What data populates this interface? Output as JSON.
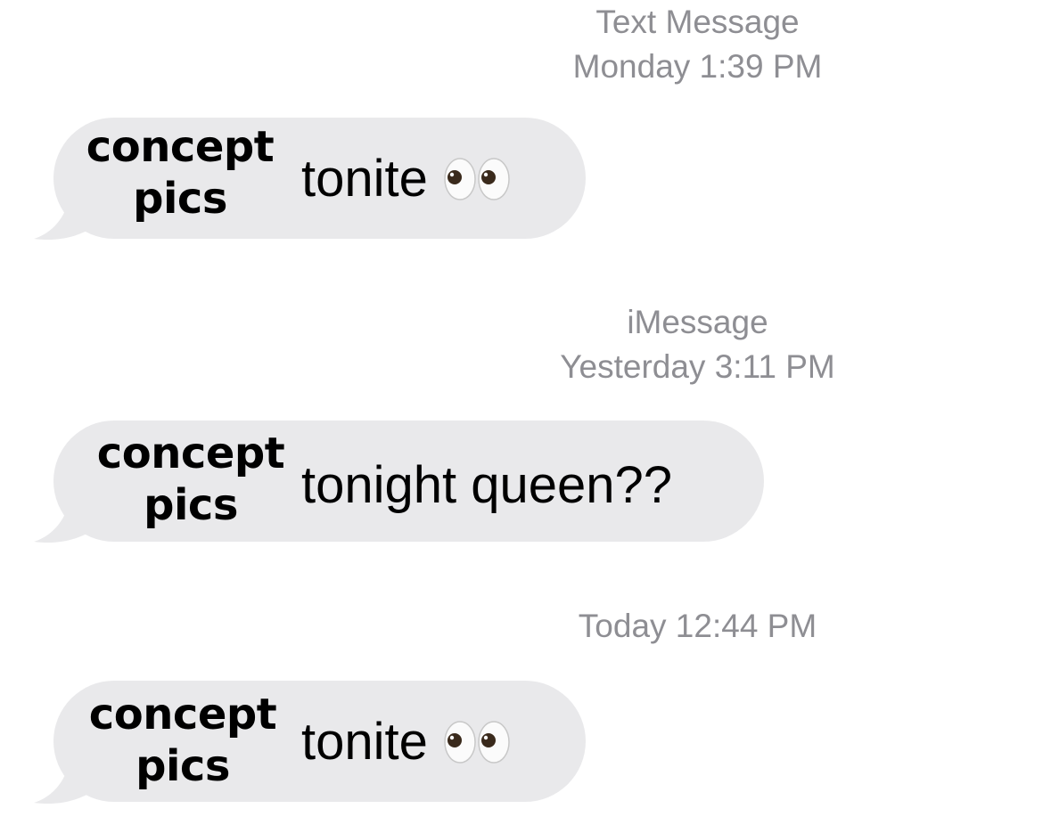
{
  "thread": [
    {
      "service": "Text Message",
      "time": "Monday 1:39 PM",
      "overlay_line1": "concept",
      "overlay_line2": "pics",
      "text": "tonite",
      "icon": "eyes-emoji-icon"
    },
    {
      "service": "iMessage",
      "time": "Yesterday 3:11 PM",
      "overlay_line1": "concept",
      "overlay_line2": "pics",
      "text": "tonight queen??"
    },
    {
      "service": "",
      "time": "Today 12:44 PM",
      "overlay_line1": "concept",
      "overlay_line2": "pics",
      "text": "tonite",
      "icon": "eyes-emoji-icon"
    }
  ],
  "colors": {
    "bubble": "#e9e9eb",
    "timestamp": "#8e8e93",
    "text": "#000000"
  }
}
